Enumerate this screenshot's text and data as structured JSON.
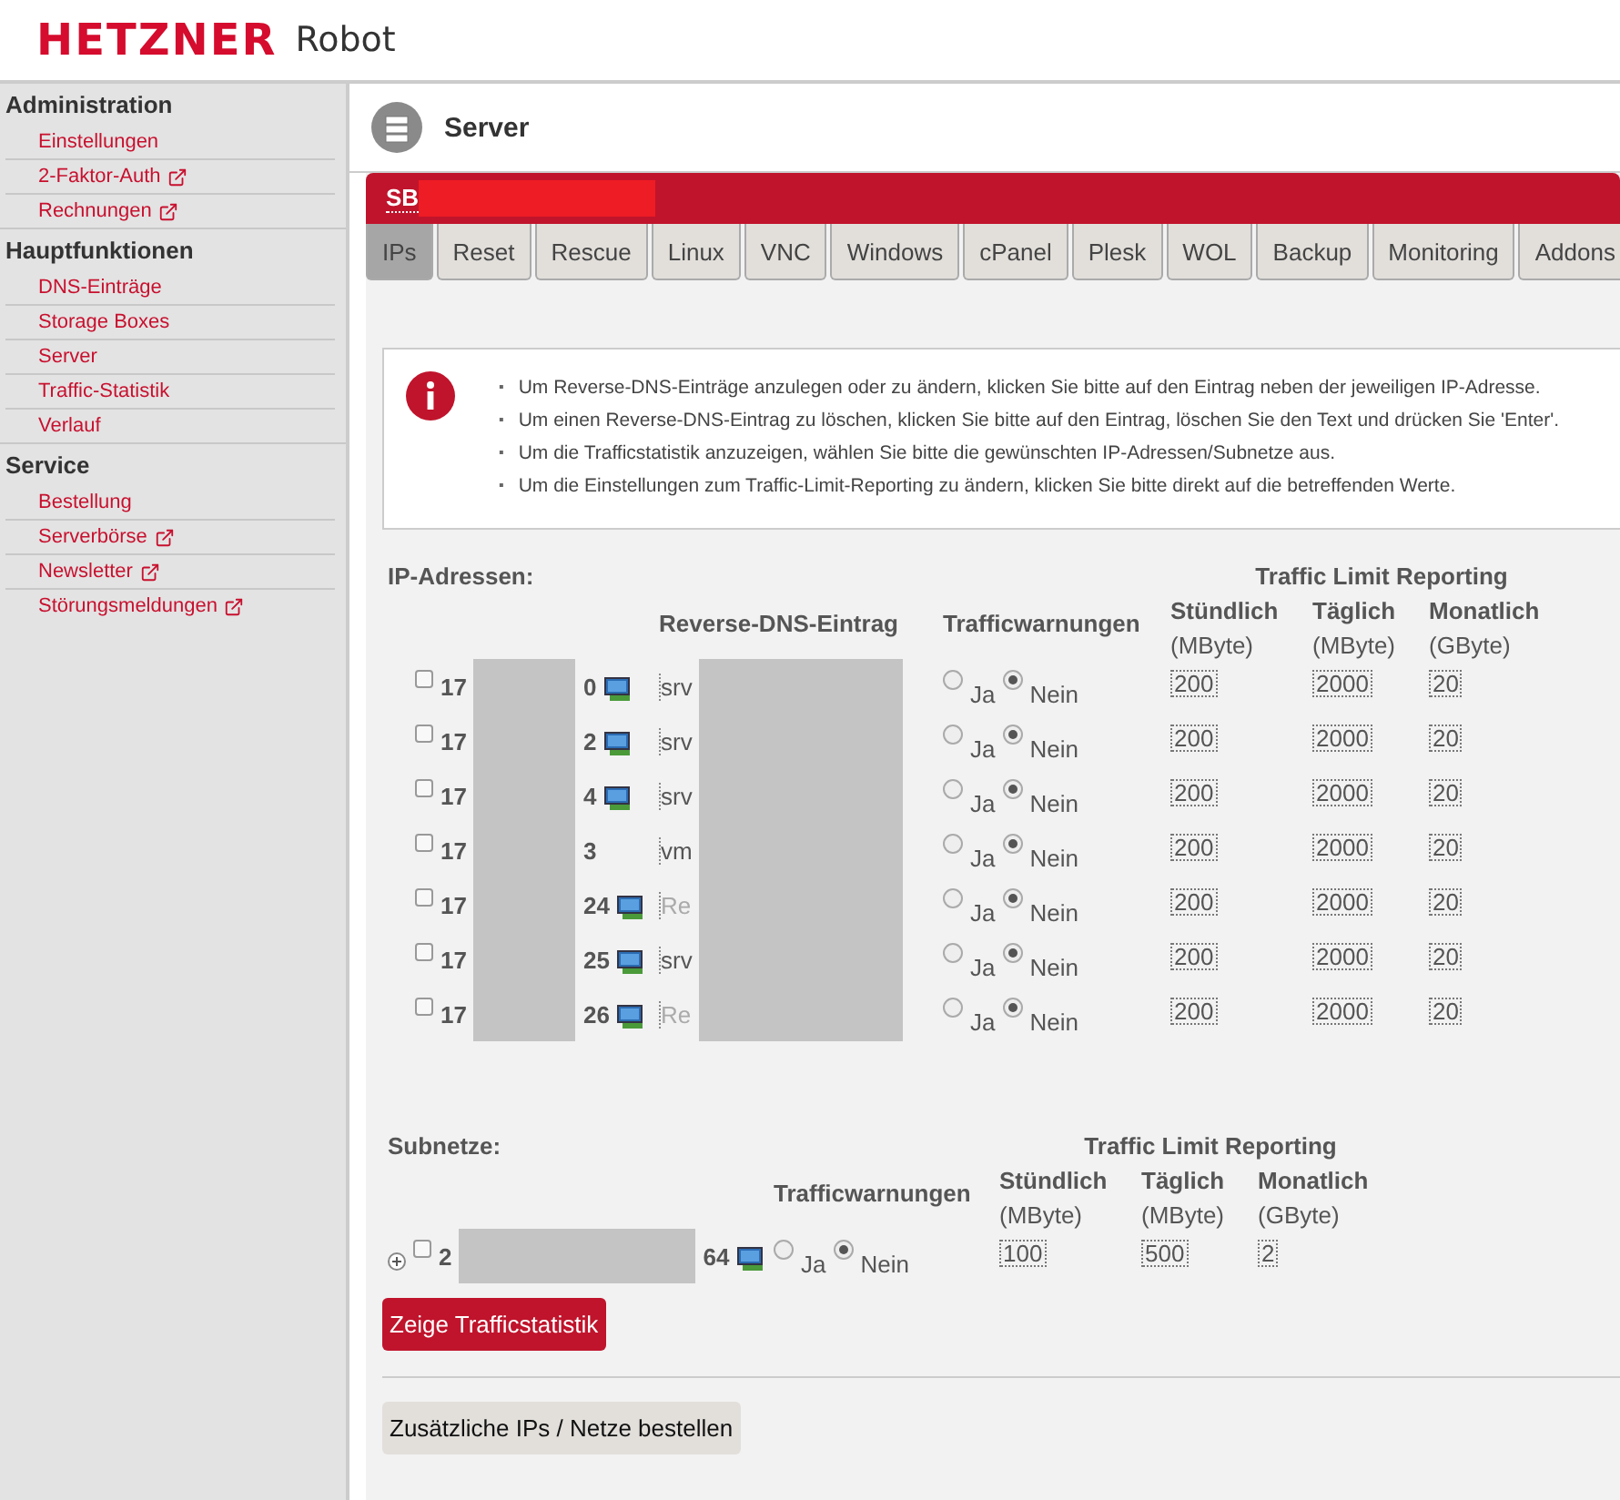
{
  "header": {
    "logo": "HETZNER",
    "product": "Robot"
  },
  "sidebar": {
    "sections": [
      {
        "title": "Administration",
        "items": [
          {
            "label": "Einstellungen",
            "external": false
          },
          {
            "label": "2-Faktor-Auth",
            "external": true
          },
          {
            "label": "Rechnungen",
            "external": true
          }
        ]
      },
      {
        "title": "Hauptfunktionen",
        "items": [
          {
            "label": "DNS-Einträge",
            "external": false
          },
          {
            "label": "Storage Boxes",
            "external": false
          },
          {
            "label": "Server",
            "external": false
          },
          {
            "label": "Traffic-Statistik",
            "external": false
          },
          {
            "label": "Verlauf",
            "external": false
          }
        ]
      },
      {
        "title": "Service",
        "items": [
          {
            "label": "Bestellung",
            "external": false
          },
          {
            "label": "Serverbörse",
            "external": true
          },
          {
            "label": "Newsletter",
            "external": true
          },
          {
            "label": "Störungsmeldungen",
            "external": true
          }
        ]
      }
    ]
  },
  "page_title": "Server",
  "server_bar": {
    "name": "SB"
  },
  "tabs": [
    {
      "label": "IPs",
      "selected": true
    },
    {
      "label": "Reset",
      "selected": false
    },
    {
      "label": "Rescue",
      "selected": false
    },
    {
      "label": "Linux",
      "selected": false
    },
    {
      "label": "VNC",
      "selected": false
    },
    {
      "label": "Windows",
      "selected": false
    },
    {
      "label": "cPanel",
      "selected": false
    },
    {
      "label": "Plesk",
      "selected": false
    },
    {
      "label": "WOL",
      "selected": false
    },
    {
      "label": "Backup",
      "selected": false
    },
    {
      "label": "Monitoring",
      "selected": false
    },
    {
      "label": "Addons",
      "selected": false
    }
  ],
  "info": {
    "lines": [
      {
        "bullet": "▪",
        "text": "Um Reverse-DNS-Einträge anzulegen oder zu ändern, klicken Sie bitte auf den Eintrag neben der jeweiligen IP-Adresse."
      },
      {
        "bullet": "▪",
        "text": "Um einen Reverse-DNS-Eintrag zu löschen, klicken Sie bitte auf den Eintrag, löschen Sie den Text und drücken Sie 'Enter'."
      },
      {
        "bullet": "▪",
        "text": "Um die Trafficstatistik anzuzeigen, wählen Sie bitte die gewünschten IP-Adressen/Subnetze aus."
      },
      {
        "bullet": "▪",
        "text": "Um die Einstellungen zum Traffic-Limit-Reporting zu ändern, klicken Sie bitte direkt auf die betreffenden Werte."
      }
    ]
  },
  "ip_section": {
    "title": "IP-Adressen:",
    "group_heading": "Traffic Limit Reporting",
    "rdns_heading": "Reverse-DNS-Eintrag",
    "warnings_heading": "Trafficwarnungen",
    "limits": [
      {
        "label": "Stündlich",
        "unit": "(MByte)"
      },
      {
        "label": "Täglich",
        "unit": "(MByte)"
      },
      {
        "label": "Monatlich",
        "unit": "(GByte)"
      }
    ],
    "rows": [
      {
        "checked": false,
        "ip_start": "17",
        "ip_end": "0",
        "monitor": true,
        "rdns": "srv",
        "rdns_empty": false,
        "yes_label": "Ja",
        "no_label": "Nein",
        "warnings": false,
        "hourly": "200",
        "daily": "2000",
        "monthly": "20"
      },
      {
        "checked": false,
        "ip_start": "17",
        "ip_end": "2",
        "monitor": true,
        "rdns": "srv",
        "rdns_empty": false,
        "yes_label": "Ja",
        "no_label": "Nein",
        "warnings": false,
        "hourly": "200",
        "daily": "2000",
        "monthly": "20"
      },
      {
        "checked": false,
        "ip_start": "17",
        "ip_end": "4",
        "monitor": true,
        "rdns": "srv",
        "rdns_empty": false,
        "yes_label": "Ja",
        "no_label": "Nein",
        "warnings": false,
        "hourly": "200",
        "daily": "2000",
        "monthly": "20"
      },
      {
        "checked": false,
        "ip_start": "17",
        "ip_end": "3",
        "monitor": false,
        "rdns": "vm",
        "rdns_empty": false,
        "yes_label": "Ja",
        "no_label": "Nein",
        "warnings": false,
        "hourly": "200",
        "daily": "2000",
        "monthly": "20"
      },
      {
        "checked": false,
        "ip_start": "17",
        "ip_end": "24",
        "monitor": true,
        "rdns": "Re",
        "rdns_empty": true,
        "yes_label": "Ja",
        "no_label": "Nein",
        "warnings": false,
        "hourly": "200",
        "daily": "2000",
        "monthly": "20"
      },
      {
        "checked": false,
        "ip_start": "17",
        "ip_end": "25",
        "monitor": true,
        "rdns": "srv",
        "rdns_empty": false,
        "yes_label": "Ja",
        "no_label": "Nein",
        "warnings": false,
        "hourly": "200",
        "daily": "2000",
        "monthly": "20"
      },
      {
        "checked": false,
        "ip_start": "17",
        "ip_end": "26",
        "monitor": true,
        "rdns": "Re",
        "rdns_empty": true,
        "yes_label": "Ja",
        "no_label": "Nein",
        "warnings": false,
        "hourly": "200",
        "daily": "2000",
        "monthly": "20"
      }
    ]
  },
  "subnet_section": {
    "title": "Subnetze:",
    "group_heading": "Traffic Limit Reporting",
    "warnings_heading": "Trafficwarnungen",
    "limits": [
      {
        "label": "Stündlich",
        "unit": "(MByte)"
      },
      {
        "label": "Täglich",
        "unit": "(MByte)"
      },
      {
        "label": "Monatlich",
        "unit": "(GByte)"
      }
    ],
    "rows": [
      {
        "expanded": false,
        "checked": false,
        "net_start": "2",
        "net_end": "64",
        "monitor": true,
        "yes_label": "Ja",
        "no_label": "Nein",
        "warnings": false,
        "hourly": "100",
        "daily": "500",
        "monthly": "2"
      }
    ]
  },
  "buttons": {
    "stats": "Zeige Trafficstatistik",
    "order": "Zusätzliche IPs / Netze bestellen"
  }
}
